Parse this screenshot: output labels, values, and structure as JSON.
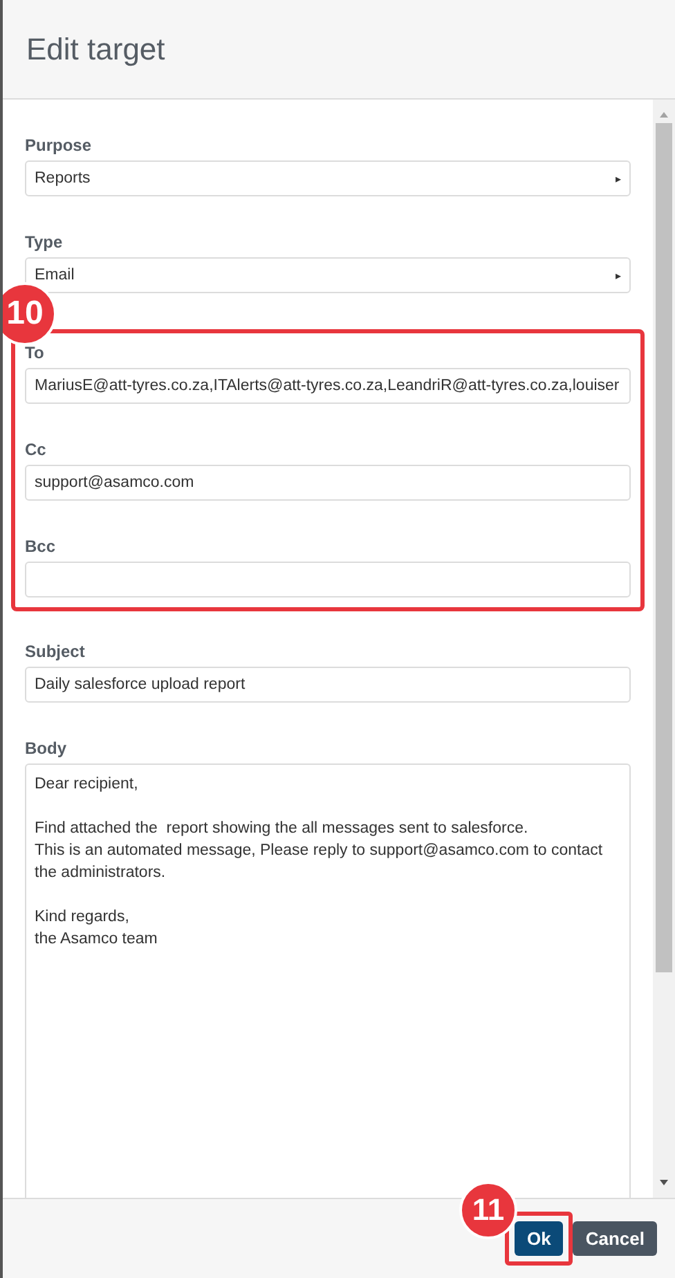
{
  "dialog": {
    "title": "Edit target"
  },
  "fields": [
    {
      "kind": "select",
      "label": "Purpose",
      "value": "Reports",
      "arrow": "▸"
    },
    {
      "kind": "select",
      "label": "Type",
      "value": "Email",
      "arrow": "▸"
    }
  ],
  "highlighted_fields": {
    "badge": "10",
    "fields": [
      {
        "kind": "input",
        "label": "To",
        "value": "MariusE@att-tyres.co.za,ITAlerts@att-tyres.co.za,LeandriR@att-tyres.co.za,louiser"
      },
      {
        "kind": "input",
        "label": "Cc",
        "value": "support@asamco.com"
      },
      {
        "kind": "input",
        "label": "Bcc"
      }
    ]
  },
  "fields_after": [
    {
      "kind": "input",
      "label": "Subject",
      "value": "Daily salesforce upload report"
    },
    {
      "kind": "textarea",
      "label": "Body",
      "value": "Dear recipient,\n\nFind attached the  report showing the all messages sent to salesforce.\nThis is an automated message, Please reply to support@asamco.com to contact the administrators.\n\nKind regards,\nthe Asamco team"
    }
  ],
  "footer": {
    "badge": "11",
    "buttons": [
      {
        "kind": "primary",
        "label": "Ok",
        "highlighted": true
      },
      {
        "kind": "secondary",
        "label": "Cancel",
        "highlighted": false
      }
    ]
  }
}
